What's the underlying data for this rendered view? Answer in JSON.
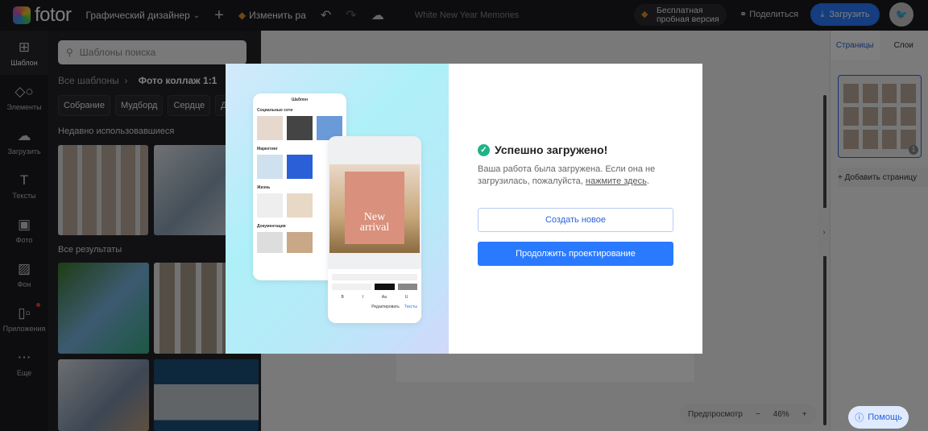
{
  "topbar": {
    "logo": "fotor",
    "mode": "Графический дизайнер",
    "upgrade": "Изменить ра",
    "doc_title": "White New Year Memories",
    "trial_line1": "Бесплатная",
    "trial_line2": "пробная версия",
    "share": "Поделиться",
    "download": "Загрузить"
  },
  "rail": [
    {
      "label": "Шаблон",
      "icon": "template-icon"
    },
    {
      "label": "Элементы",
      "icon": "elements-icon"
    },
    {
      "label": "Загрузить",
      "icon": "upload-icon"
    },
    {
      "label": "Тексты",
      "icon": "text-icon"
    },
    {
      "label": "Фото",
      "icon": "photo-icon"
    },
    {
      "label": "Фон",
      "icon": "background-icon"
    },
    {
      "label": "Приложения",
      "icon": "apps-icon"
    },
    {
      "label": "Еще",
      "icon": "more-icon"
    }
  ],
  "panel": {
    "search_placeholder": "Шаблоны поиска",
    "breadcrumb_root": "Все шаблоны",
    "breadcrumb_current": "Фото коллаж 1:1",
    "chips": [
      "Собрание",
      "Мудборд",
      "Сердце",
      "День"
    ],
    "recent": "Недавно использовавшиеся",
    "all_results": "Все результаты"
  },
  "right": {
    "tab_pages": "Страницы",
    "tab_layers": "Слои",
    "page_number": "1",
    "add_page": "+ Добавить страницу"
  },
  "canvas": {
    "preview": "Предпросмотр",
    "zoom": "46%"
  },
  "help": "Помощь",
  "modal": {
    "title": "Успешно загружено!",
    "desc": "Ваша работа была загружена. Если она не загрузилась, пожалуйста,",
    "link": "нажмите здесь",
    "create_new": "Создать новое",
    "continue": "Продолжить проектирование",
    "phone": {
      "header": "Шаблон",
      "sections": [
        "Социальные сети",
        "Маркетинг",
        "Жизнь",
        "Документация"
      ],
      "poster_line1": "New",
      "poster_line2": "arrival",
      "tab_text": "Тексты",
      "tab_edit": "Редактировать"
    }
  }
}
